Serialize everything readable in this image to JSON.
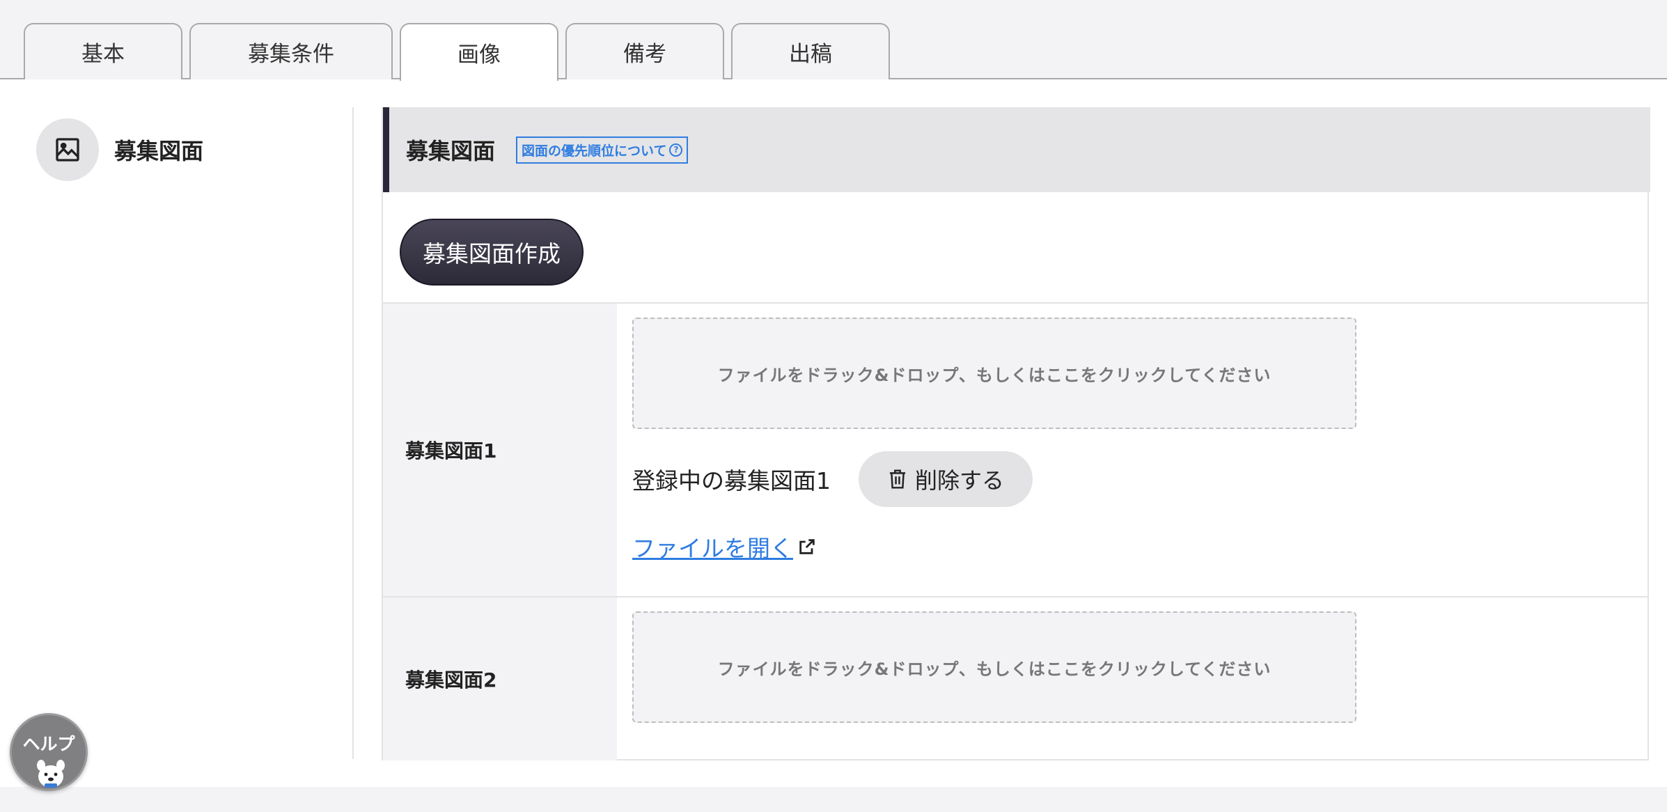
{
  "tabs": [
    {
      "label": "基本",
      "active": false
    },
    {
      "label": "募集条件",
      "active": false
    },
    {
      "label": "画像",
      "active": true
    },
    {
      "label": "備考",
      "active": false
    },
    {
      "label": "出稿",
      "active": false
    }
  ],
  "sidebar": {
    "items": [
      {
        "label": "募集図面",
        "icon": "image-icon"
      }
    ]
  },
  "section": {
    "title": "募集図面",
    "priority_link": "図面の優先順位について",
    "create_button": "募集図面作成",
    "rows": [
      {
        "label": "募集図面1",
        "dropzone_text": "ファイルをドラック&ドロップ、もしくはここをクリックしてください",
        "registered_text": "登録中の募集図面1",
        "delete_button": "削除する",
        "open_link": "ファイルを開く"
      },
      {
        "label": "募集図面2",
        "dropzone_text": "ファイルをドラック&ドロップ、もしくはここをクリックしてください"
      }
    ]
  },
  "help": {
    "label": "ヘルプ"
  },
  "colors": {
    "accent_dark": "#2c2a38",
    "link_blue": "#2f7de1",
    "panel_gray": "#f3f3f5"
  }
}
